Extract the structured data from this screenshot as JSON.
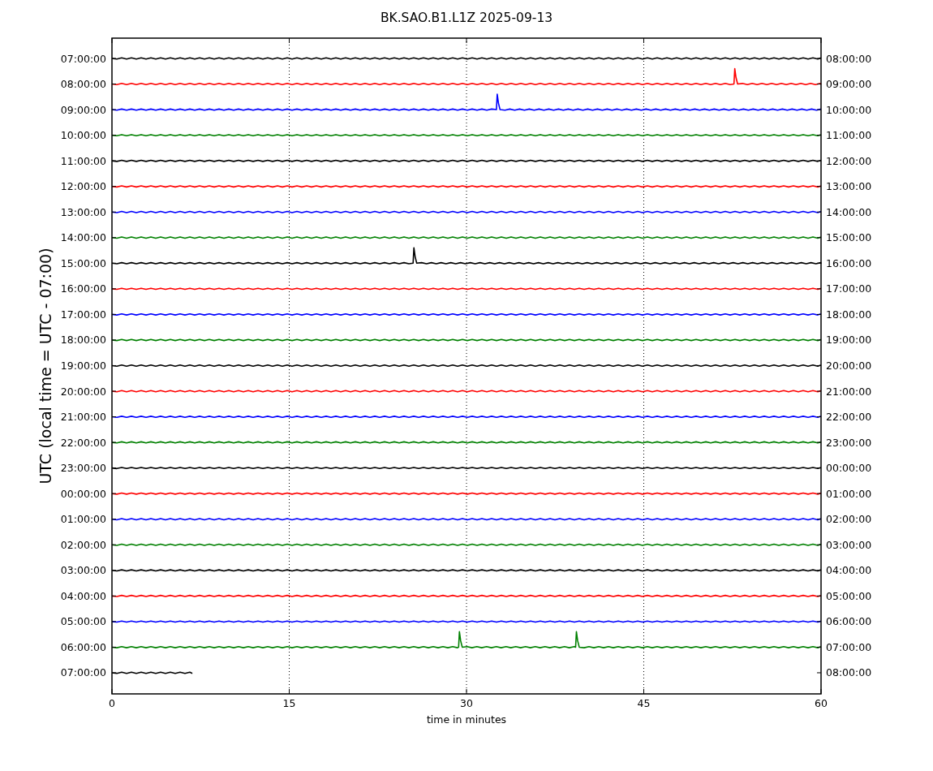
{
  "title": "BK.SAO.B1.L1Z 2025-09-13",
  "ylabel": "UTC (local time = UTC - 07:00)",
  "xlabel": "time in minutes",
  "xticks": [
    "0",
    "15",
    "30",
    "45",
    "60"
  ],
  "rows": [
    {
      "left": "07:00:00",
      "right": "08:00:00",
      "color": "#000000"
    },
    {
      "left": "08:00:00",
      "right": "09:00:00",
      "color": "#ff0000"
    },
    {
      "left": "09:00:00",
      "right": "10:00:00",
      "color": "#0000ff"
    },
    {
      "left": "10:00:00",
      "right": "11:00:00",
      "color": "#008000"
    },
    {
      "left": "11:00:00",
      "right": "12:00:00",
      "color": "#000000"
    },
    {
      "left": "12:00:00",
      "right": "13:00:00",
      "color": "#ff0000"
    },
    {
      "left": "13:00:00",
      "right": "14:00:00",
      "color": "#0000ff"
    },
    {
      "left": "14:00:00",
      "right": "15:00:00",
      "color": "#008000"
    },
    {
      "left": "15:00:00",
      "right": "16:00:00",
      "color": "#000000"
    },
    {
      "left": "16:00:00",
      "right": "17:00:00",
      "color": "#ff0000"
    },
    {
      "left": "17:00:00",
      "right": "18:00:00",
      "color": "#0000ff"
    },
    {
      "left": "18:00:00",
      "right": "19:00:00",
      "color": "#008000"
    },
    {
      "left": "19:00:00",
      "right": "20:00:00",
      "color": "#000000"
    },
    {
      "left": "20:00:00",
      "right": "21:00:00",
      "color": "#ff0000"
    },
    {
      "left": "21:00:00",
      "right": "22:00:00",
      "color": "#0000ff"
    },
    {
      "left": "22:00:00",
      "right": "23:00:00",
      "color": "#008000"
    },
    {
      "left": "23:00:00",
      "right": "00:00:00",
      "color": "#000000"
    },
    {
      "left": "00:00:00",
      "right": "01:00:00",
      "color": "#ff0000"
    },
    {
      "left": "01:00:00",
      "right": "02:00:00",
      "color": "#0000ff"
    },
    {
      "left": "02:00:00",
      "right": "03:00:00",
      "color": "#008000"
    },
    {
      "left": "03:00:00",
      "right": "04:00:00",
      "color": "#000000"
    },
    {
      "left": "04:00:00",
      "right": "05:00:00",
      "color": "#ff0000"
    },
    {
      "left": "05:00:00",
      "right": "06:00:00",
      "color": "#0000ff"
    },
    {
      "left": "06:00:00",
      "right": "07:00:00",
      "color": "#008000"
    },
    {
      "left": "07:00:00",
      "right": "08:00:00",
      "color": "#000000"
    }
  ]
}
